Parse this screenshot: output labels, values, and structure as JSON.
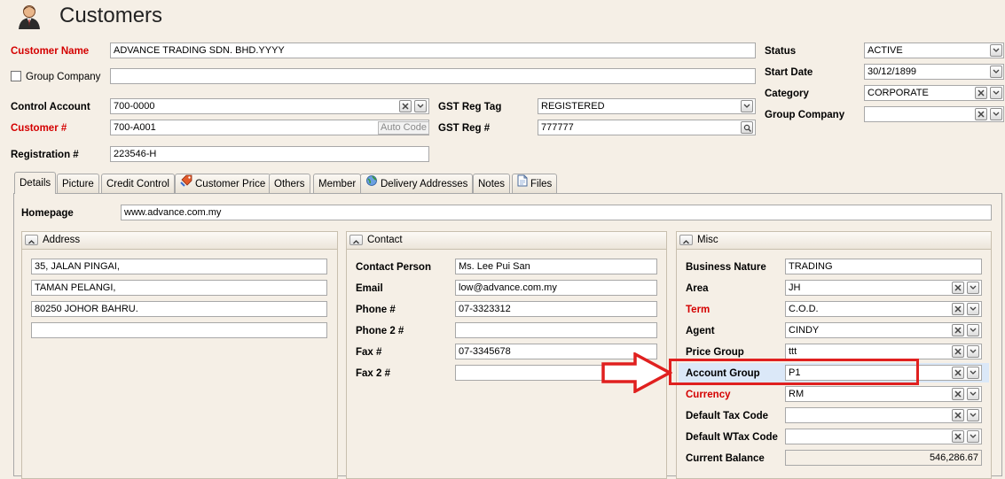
{
  "window": {
    "title": "Customers",
    "icon": "customer-user-icon"
  },
  "header": {
    "customer_name_label": "Customer Name",
    "customer_name": "ADVANCE TRADING SDN. BHD.YYYY",
    "group_company_check_label": "Group Company",
    "group_company_text": "",
    "control_account_label": "Control Account",
    "control_account": "700-0000",
    "customer_no_label": "Customer #",
    "customer_no": "700-A001",
    "auto_code_label": "Auto Code",
    "registration_label": "Registration #",
    "registration": "223546-H",
    "gst_reg_tag_label": "GST Reg Tag",
    "gst_reg_tag": "REGISTERED",
    "gst_reg_no_label": "GST Reg #",
    "gst_reg_no": "777777",
    "status_label": "Status",
    "status": "ACTIVE",
    "start_date_label": "Start Date",
    "start_date": "30/12/1899",
    "category_label": "Category",
    "category": "CORPORATE",
    "group_company_label": "Group Company",
    "group_company": ""
  },
  "tabs": [
    {
      "label": "Details",
      "icon": ""
    },
    {
      "label": "Picture",
      "icon": ""
    },
    {
      "label": "Credit Control",
      "icon": ""
    },
    {
      "label": "Customer Price",
      "icon": "price-tag-icon"
    },
    {
      "label": "Others",
      "icon": ""
    },
    {
      "label": "Member",
      "icon": ""
    },
    {
      "label": "Delivery Addresses",
      "icon": "globe-icon"
    },
    {
      "label": "Notes",
      "icon": ""
    },
    {
      "label": "Files",
      "icon": "file-icon"
    }
  ],
  "details": {
    "homepage_label": "Homepage",
    "homepage": "www.advance.com.my",
    "address": {
      "title": "Address",
      "lines": [
        "35, JALAN PINGAI,",
        "TAMAN PELANGI,",
        "80250 JOHOR BAHRU.",
        ""
      ]
    },
    "contact": {
      "title": "Contact",
      "fields": [
        {
          "label": "Contact Person",
          "value": "Ms. Lee Pui San"
        },
        {
          "label": "Email",
          "value": "low@advance.com.my"
        },
        {
          "label": "Phone #",
          "value": "07-3323312"
        },
        {
          "label": "Phone 2 #",
          "value": ""
        },
        {
          "label": "Fax #",
          "value": "07-3345678"
        },
        {
          "label": "Fax 2 #",
          "value": ""
        }
      ]
    },
    "misc": {
      "title": "Misc",
      "fields": [
        {
          "label": "Business Nature",
          "value": "TRADING"
        },
        {
          "label": "Area",
          "value": "JH"
        },
        {
          "label": "Term",
          "value": "C.O.D."
        },
        {
          "label": "Agent",
          "value": "CINDY"
        },
        {
          "label": "Price Group",
          "value": "ttt"
        },
        {
          "label": "Account Group",
          "value": "P1"
        },
        {
          "label": "Currency",
          "value": "RM"
        },
        {
          "label": "Default Tax Code",
          "value": ""
        },
        {
          "label": "Default WTax Code",
          "value": ""
        },
        {
          "label": "Current Balance",
          "value": "546,286.67"
        }
      ]
    }
  },
  "colors": {
    "required_label": "#d40000",
    "annotation_red": "#e0201f",
    "highlight_row": "#dbe8f8"
  }
}
